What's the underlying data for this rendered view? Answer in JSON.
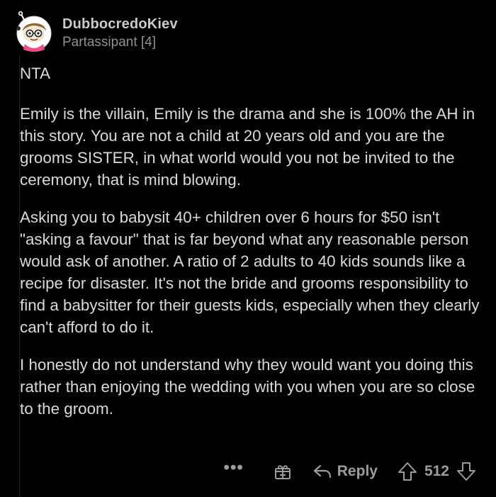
{
  "comment": {
    "username": "DubbocredoKiev",
    "flair": "Partassipant [4]",
    "paragraphs": [
      "NTA",
      "Emily is the villain, Emily is the drama and she is 100% the AH in this story. You are not a child at 20 years old and you are the grooms SISTER, in what world would you not be invited to the ceremony, that is mind blowing.",
      "Asking you to babysit 40+ children over 6 hours for $50 isn't \"asking a favour\" that is far beyond what any reasonable person would ask of another. A ratio of 2 adults to 40 kids sounds like a recipe for disaster. It's not the bride and grooms responsibility to find a babysitter for their guests kids, especially when they clearly can't afford to do it.",
      "I honestly do not understand why they would want you doing this rather than enjoying the wedding with you when you are so close to the groom."
    ]
  },
  "actions": {
    "more_label": "•••",
    "award_icon": "gift-award-icon",
    "reply_label": "Reply",
    "reply_icon": "reply-arrow-icon",
    "upvote_icon": "upvote-arrow-icon",
    "vote_count": "512",
    "downvote_icon": "downvote-arrow-icon"
  },
  "colors": {
    "background": "#000000",
    "text": "#d7dadc",
    "muted": "#9a9da0",
    "avatar_accent": "#e84a8a"
  }
}
